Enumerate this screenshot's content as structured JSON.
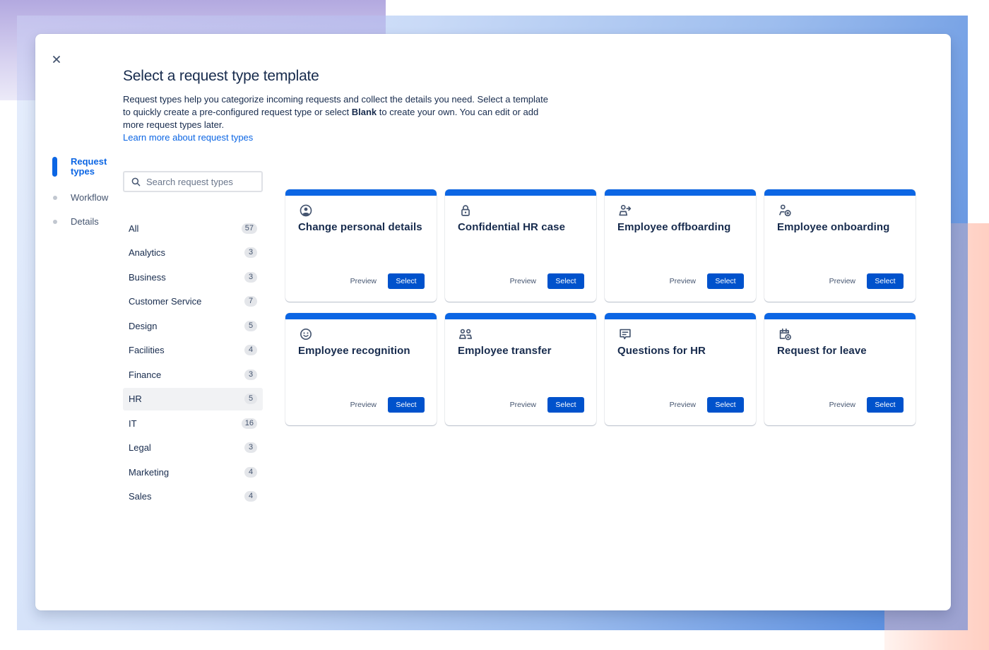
{
  "modal": {
    "title": "Select a request type template",
    "description_part1": "Request types help you categorize incoming requests and collect the details you need. Select a template to quickly create a pre-configured request type or select ",
    "description_bold": "Blank",
    "description_part2": " to create your own. You can edit or add more request types later.",
    "learn_more_link": "Learn more about request types",
    "close_label": "×"
  },
  "steps": [
    {
      "label": "Request types",
      "active": true
    },
    {
      "label": "Workflow",
      "active": false
    },
    {
      "label": "Details",
      "active": false
    }
  ],
  "search": {
    "placeholder": "Search request types",
    "value": ""
  },
  "categories": [
    {
      "label": "All",
      "count": "57"
    },
    {
      "label": "Analytics",
      "count": "3"
    },
    {
      "label": "Business",
      "count": "3"
    },
    {
      "label": "Customer Service",
      "count": "7"
    },
    {
      "label": "Design",
      "count": "5"
    },
    {
      "label": "Facilities",
      "count": "4"
    },
    {
      "label": "Finance",
      "count": "3"
    },
    {
      "label": "HR",
      "count": "5",
      "selected": true
    },
    {
      "label": "IT",
      "count": "16"
    },
    {
      "label": "Legal",
      "count": "3"
    },
    {
      "label": "Marketing",
      "count": "4"
    },
    {
      "label": "Sales",
      "count": "4"
    }
  ],
  "cards": [
    {
      "title": "Change personal details",
      "icon": "person-circle-icon"
    },
    {
      "title": "Confidential HR case",
      "icon": "lock-icon"
    },
    {
      "title": "Employee offboarding",
      "icon": "person-arrow-right-icon"
    },
    {
      "title": "Employee onboarding",
      "icon": "person-add-icon"
    },
    {
      "title": "Employee recognition",
      "icon": "smiley-icon"
    },
    {
      "title": "Employee transfer",
      "icon": "people-icon"
    },
    {
      "title": "Questions for HR",
      "icon": "comment-icon"
    },
    {
      "title": "Request for leave",
      "icon": "calendar-add-icon"
    }
  ],
  "card_actions": {
    "preview_label": "Preview",
    "select_label": "Select"
  },
  "colors": {
    "accent": "#0c66e4",
    "button": "#0052cc",
    "text": "#172b4d",
    "subtle_text": "#44546f"
  }
}
